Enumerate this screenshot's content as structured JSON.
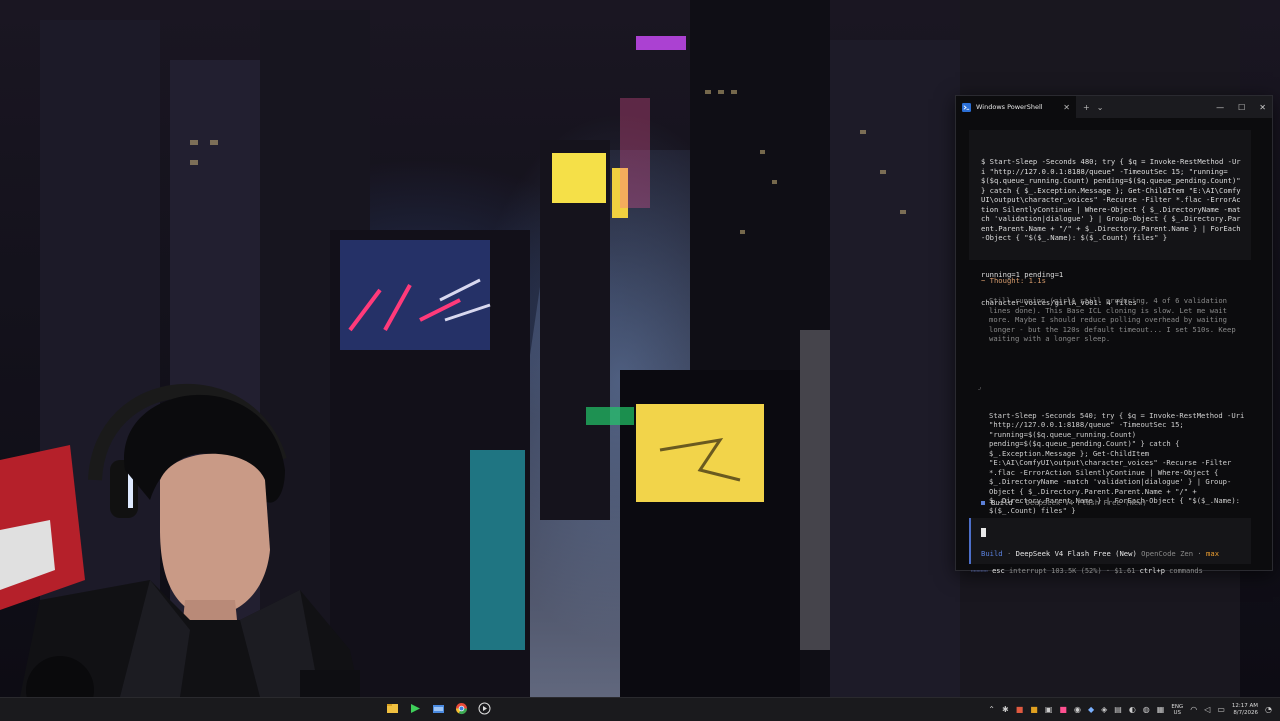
{
  "terminal": {
    "tab_title": "Windows PowerShell",
    "tab_close": "✕",
    "new_tab": "+",
    "dropdown": "⌄",
    "minimize": "—",
    "maximize": "☐",
    "close": "✕",
    "command1": "$ Start-Sleep -Seconds 480; try { $q = Invoke-RestMethod -Uri \"http://127.0.0.1:8188/queue\" -TimeoutSec 15; \"running=$($q.queue_running.Count) pending=$($q.queue_pending.Count)\" } catch { $_.Exception.Message }; Get-ChildItem \"E:\\AI\\ComfyUI\\output\\character_voices\" -Recurse -Filter *.flac -ErrorAction SilentlyContinue | Where-Object { $_.DirectoryName -match 'validation|dialogue' } | Group-Object { $_.Directory.Parent.Parent.Name + \"/\" + $_.Directory.Parent.Name } | ForEach-Object { \"$($_.Name): $($_.Count) files\" }",
    "output1_line1": "running=1 pending=1",
    "output1_line2": "character_voices/girlA_v001: 4 files",
    "thought_header": "~ Thought: 1.1s",
    "thought_body": "Still running (girlA still producing, 4 of 6 validation lines done). This Base ICL cloning is slow. Let me wait more. Maybe I should reduce polling overhead by waiting longer - but the 120s default timeout... I set 510s. Keep waiting with a longer sleep.",
    "command2_arrow": "⌟",
    "command2": "Start-Sleep -Seconds 540; try { $q = Invoke-RestMethod -Uri \"http://127.0.0.1:8188/queue\" -TimeoutSec 15; \"running=$($q.queue_running.Count) pending=$($q.queue_pending.Count)\" } catch { $_.Exception.Message }; Get-ChildItem \"E:\\AI\\ComfyUI\\output\\character_voices\" -Recurse -Filter *.flac -ErrorAction SilentlyContinue | Where-Object { $_.DirectoryName -match 'validation|dialogue' } | Group-Object { $_.Directory.Parent.Parent.Name + \"/\" + $_.Directory.Parent.Name } | ForEach-Object { \"$($_.Name): $($_.Count) files\" }",
    "status_build": "Build",
    "status_model": "· DeepSeek V4 Flash Free (New)",
    "input_build": "Build",
    "input_sep": "·",
    "input_model": "DeepSeek V4 Flash Free (New)",
    "input_provider": "OpenCode Zen ·",
    "input_variant": "max",
    "bottom_dots": "⋯⋯⋯⋯",
    "bottom_esc": "esc",
    "bottom_interrupt": "interrupt",
    "bottom_tokens": "103.5K (52%) · $1.61",
    "bottom_ctrl": "ctrl+p",
    "bottom_commands": "commands"
  },
  "taskbar": {
    "apps": [
      "file-explorer-icon",
      "terminal-icon",
      "folder-icon",
      "chrome-icon",
      "media-player-icon"
    ],
    "tray_icons": [
      "chevron-up-icon",
      "bluetooth-icon",
      "network-app-icon",
      "folder-app-icon",
      "app-icon",
      "app-icon",
      "app-icon",
      "app-icon",
      "app-icon",
      "app-icon",
      "app-icon"
    ],
    "lang_top": "ENG",
    "lang_bottom": "US",
    "time": "12:17 AM",
    "date": "8/7/2026"
  },
  "colors": {
    "terminal_bg": "#0c0c0e",
    "block_bg": "#141417",
    "thought_accent": "#d69b6c",
    "build_accent": "#5b82e0",
    "max_accent": "#f0a030"
  }
}
